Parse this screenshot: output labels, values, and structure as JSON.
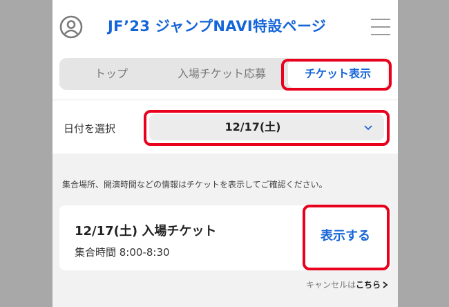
{
  "header": {
    "title": "JF’23 ジャンプNAVI特設ページ",
    "avatar_icon": "user-circle-icon",
    "menu_icon": "hamburger-menu-icon"
  },
  "tabs": [
    {
      "label": "トップ",
      "active": false
    },
    {
      "label": "入場チケット応募",
      "active": false
    },
    {
      "label": "チケット表示",
      "active": true
    }
  ],
  "date_selector": {
    "label": "日付を選択",
    "value": "12/17(土)",
    "icon": "chevron-down-icon"
  },
  "info_text": "集合場所、開演時間などの情報はチケットを表示してご確認ください。",
  "ticket": {
    "title": "12/17(土) 入場チケット",
    "time": "集合時間 8:00-8:30",
    "action_label": "表示する"
  },
  "cancel": {
    "prefix": "キャンセルは",
    "link_label": "こちら",
    "icon": "chevron-right-icon"
  },
  "colors": {
    "accent": "#1565d8",
    "highlight": "#e8001c",
    "backdrop": "#a8a8a8"
  }
}
